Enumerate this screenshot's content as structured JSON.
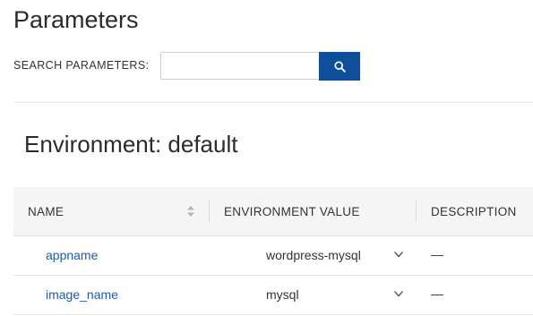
{
  "page": {
    "title": "Parameters"
  },
  "search": {
    "label": "SEARCH PARAMETERS:",
    "value": "",
    "placeholder": "",
    "button_icon": "search-icon"
  },
  "environment": {
    "heading": "Environment: default"
  },
  "table": {
    "columns": [
      "NAME",
      "ENVIRONMENT VALUE",
      "DESCRIPTION"
    ],
    "rows": [
      {
        "name": "appname",
        "value": "wordpress-mysql",
        "description": "—"
      },
      {
        "name": "image_name",
        "value": "mysql",
        "description": "—"
      }
    ]
  },
  "colors": {
    "accent": "#0f4e9a",
    "link": "#1a5cb0",
    "header_bg": "#f5f5f5"
  }
}
